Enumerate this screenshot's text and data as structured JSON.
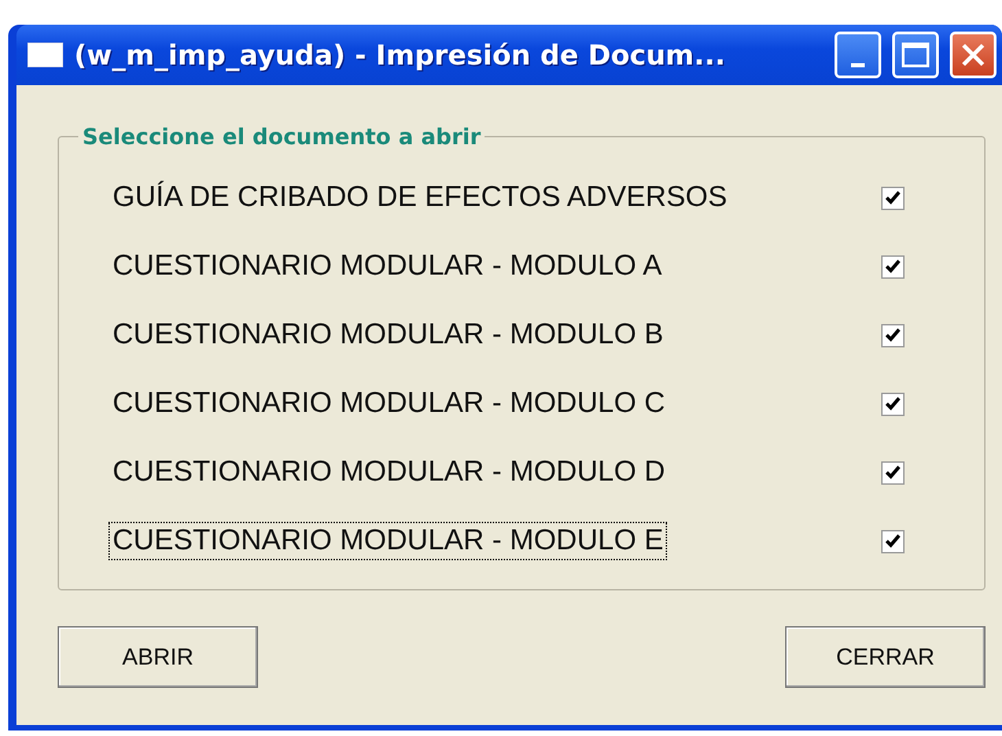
{
  "window": {
    "title": "(w_m_imp_ayuda) - Impresión de Docum..."
  },
  "group": {
    "title": "Seleccione el documento a abrir",
    "items": [
      {
        "label": "GUÍA DE CRIBADO DE EFECTOS ADVERSOS",
        "checked": true,
        "focused": false
      },
      {
        "label": "CUESTIONARIO MODULAR - MODULO A",
        "checked": true,
        "focused": false
      },
      {
        "label": "CUESTIONARIO MODULAR - MODULO B",
        "checked": true,
        "focused": false
      },
      {
        "label": "CUESTIONARIO MODULAR - MODULO C",
        "checked": true,
        "focused": false
      },
      {
        "label": "CUESTIONARIO MODULAR - MODULO D",
        "checked": true,
        "focused": false
      },
      {
        "label": "CUESTIONARIO MODULAR - MODULO E",
        "checked": true,
        "focused": true
      }
    ]
  },
  "buttons": [
    {
      "label": "ABRIR"
    },
    {
      "label": "CERRAR"
    }
  ]
}
